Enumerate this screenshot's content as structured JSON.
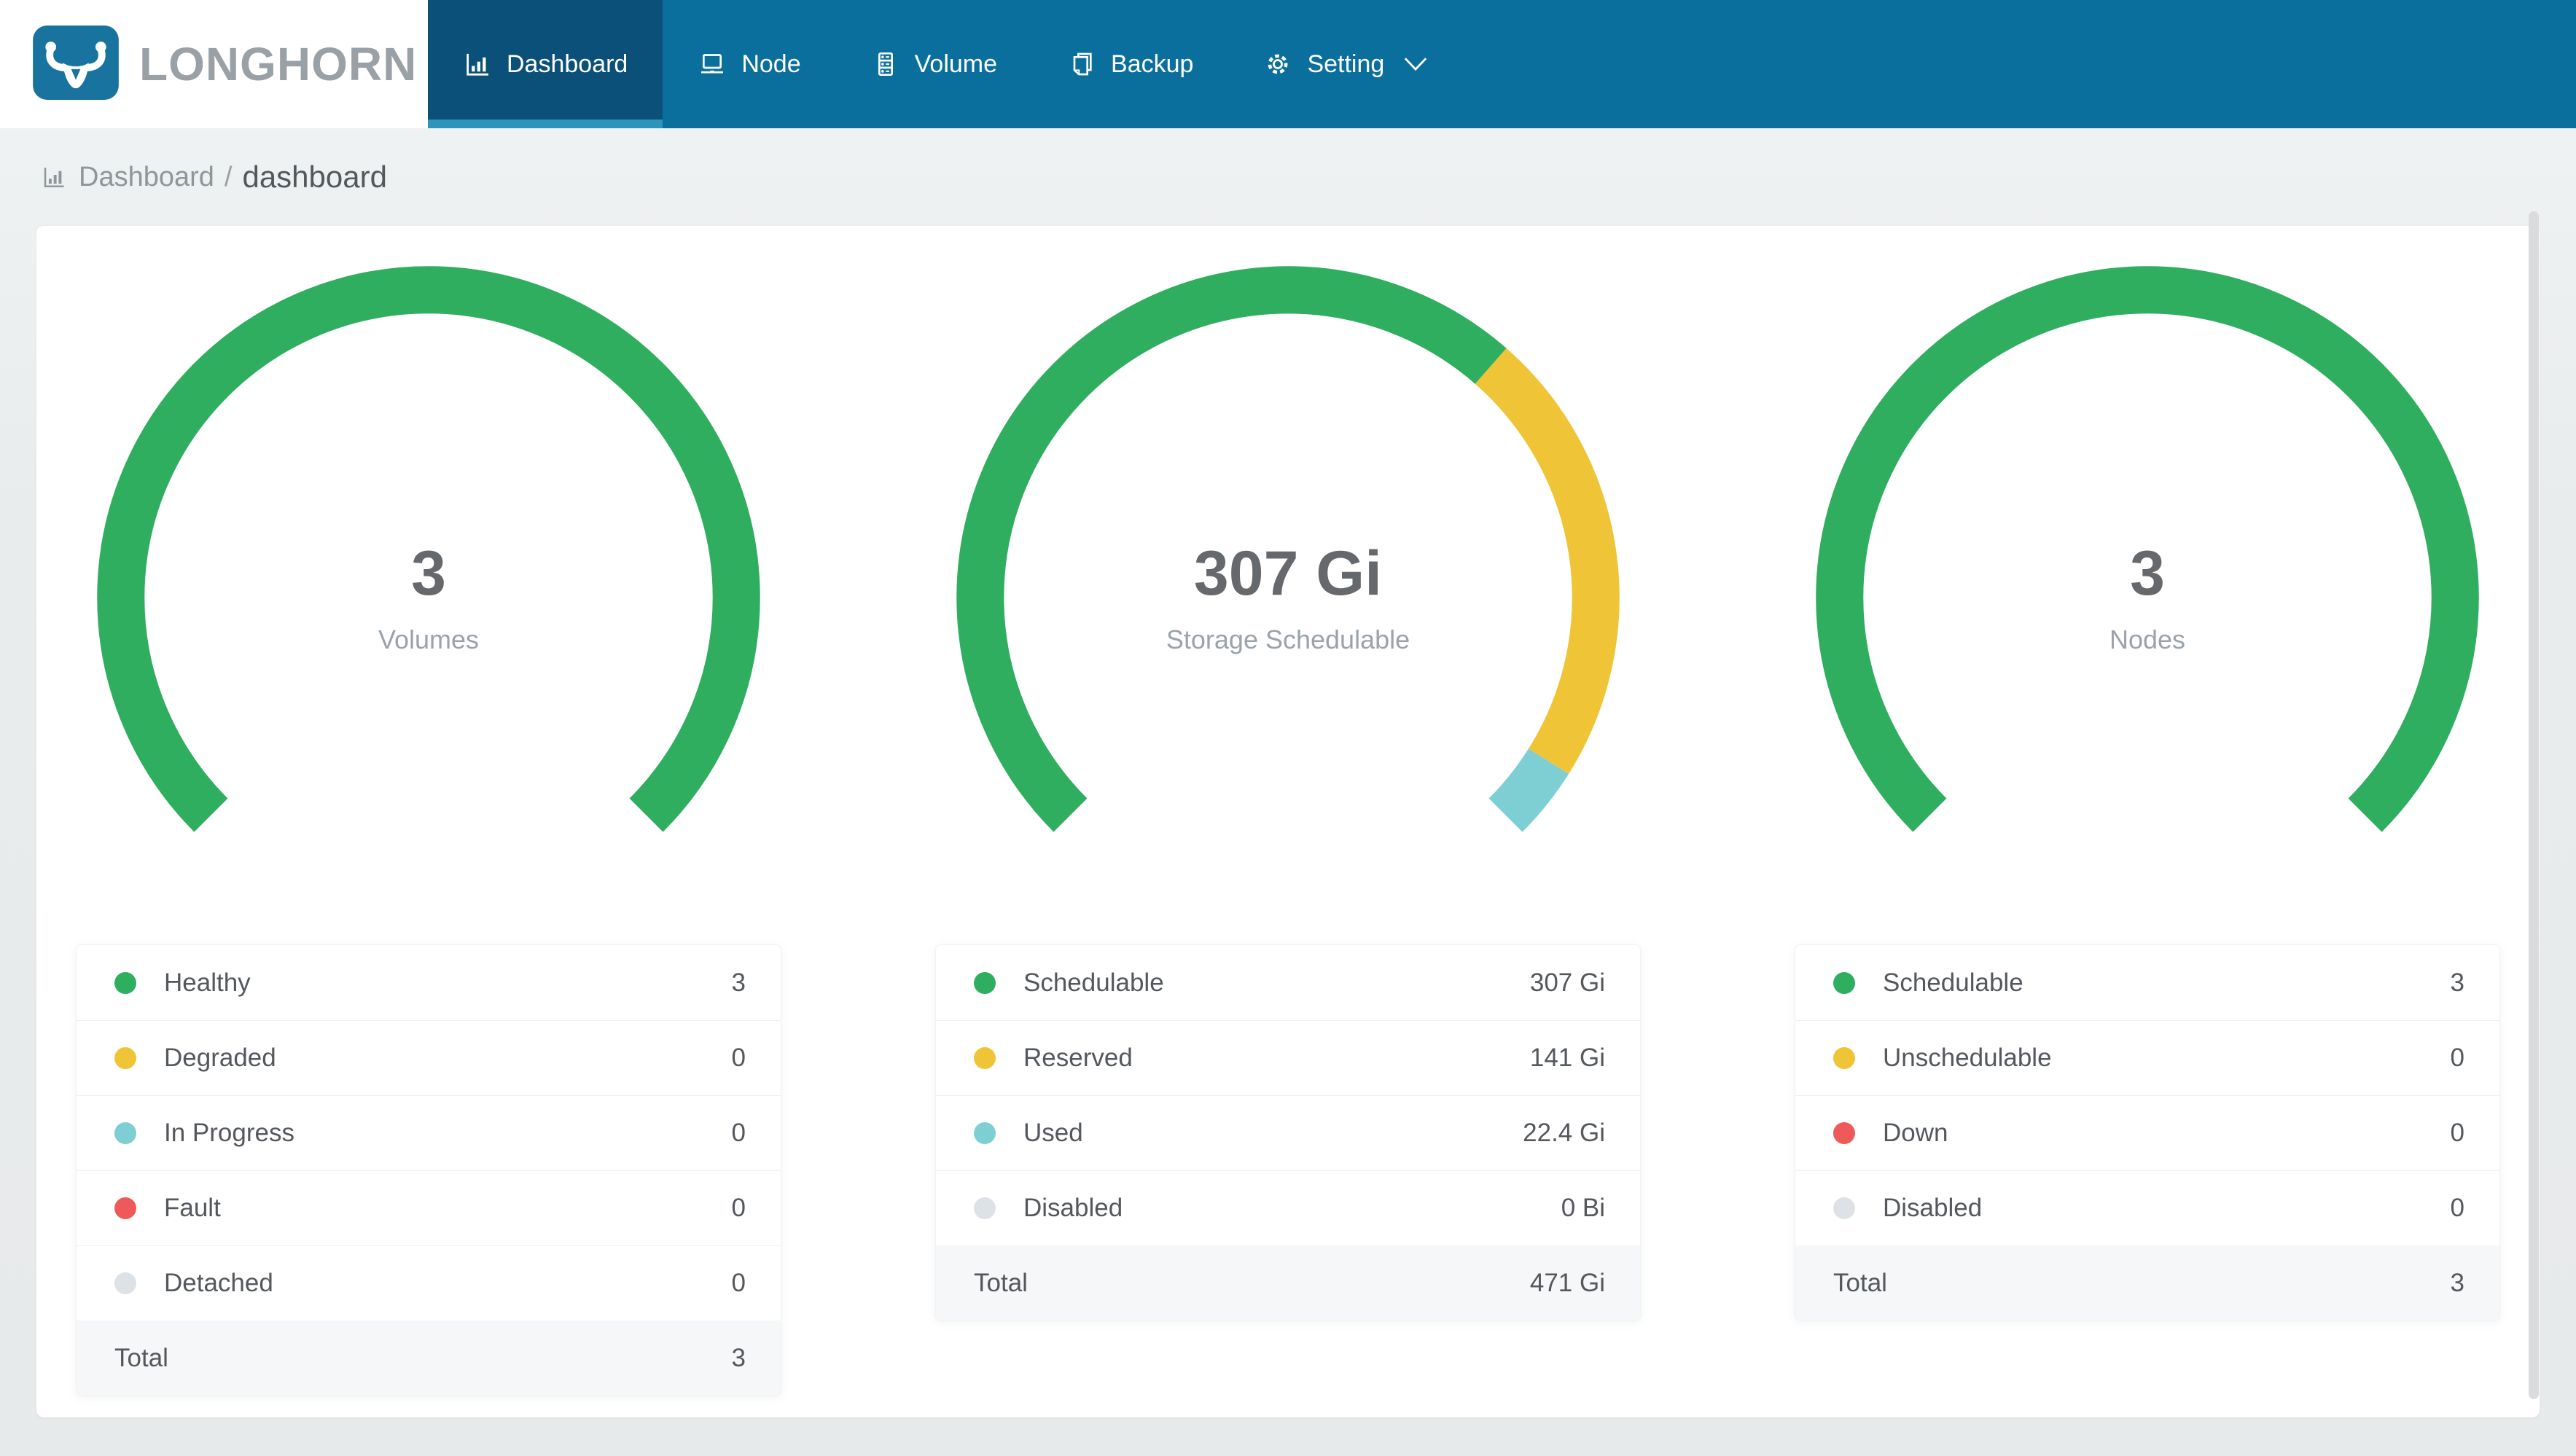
{
  "brand": {
    "name": "LONGHORN"
  },
  "colors": {
    "green": "#2fae5f",
    "yellow": "#f0c437",
    "teal": "#7ecfd4",
    "red": "#ee5a5a",
    "gray": "#dde2e6",
    "navbar": "#0b6f9d",
    "navbar_active_bg": "#0a5078",
    "navbar_active_underline": "#2b96ba",
    "logo_blue": "#18739f"
  },
  "nav": {
    "items": [
      {
        "label": "Dashboard",
        "icon": "bar-chart-icon",
        "active": true
      },
      {
        "label": "Node",
        "icon": "laptop-icon",
        "active": false
      },
      {
        "label": "Volume",
        "icon": "server-icon",
        "active": false
      },
      {
        "label": "Backup",
        "icon": "copy-icon",
        "active": false
      },
      {
        "label": "Setting",
        "icon": "gear-icon",
        "active": false,
        "has_dropdown": true
      }
    ]
  },
  "breadcrumb": {
    "section": "Dashboard",
    "separator": "/",
    "page": "dashboard"
  },
  "chart_data": [
    {
      "type": "gauge",
      "center_value": "3",
      "subtitle": "Volumes",
      "start_angle": 225,
      "arc_span": 270,
      "segments": [
        {
          "label": "Healthy",
          "value": 3,
          "display": "3",
          "color": "green"
        },
        {
          "label": "Degraded",
          "value": 0,
          "display": "0",
          "color": "yellow"
        },
        {
          "label": "In Progress",
          "value": 0,
          "display": "0",
          "color": "teal"
        },
        {
          "label": "Fault",
          "value": 0,
          "display": "0",
          "color": "red"
        },
        {
          "label": "Detached",
          "value": 0,
          "display": "0",
          "color": "gray"
        }
      ],
      "total": {
        "label": "Total",
        "display": "3"
      }
    },
    {
      "type": "gauge",
      "center_value": "307 Gi",
      "subtitle": "Storage Schedulable",
      "start_angle": 225,
      "arc_span": 270,
      "segments": [
        {
          "label": "Schedulable",
          "value": 307,
          "display": "307 Gi",
          "color": "green"
        },
        {
          "label": "Reserved",
          "value": 141,
          "display": "141 Gi",
          "color": "yellow"
        },
        {
          "label": "Used",
          "value": 22.4,
          "display": "22.4 Gi",
          "color": "teal"
        },
        {
          "label": "Disabled",
          "value": 0,
          "display": "0 Bi",
          "color": "gray"
        }
      ],
      "total": {
        "label": "Total",
        "display": "471 Gi"
      }
    },
    {
      "type": "gauge",
      "center_value": "3",
      "subtitle": "Nodes",
      "start_angle": 225,
      "arc_span": 270,
      "segments": [
        {
          "label": "Schedulable",
          "value": 3,
          "display": "3",
          "color": "green"
        },
        {
          "label": "Unschedulable",
          "value": 0,
          "display": "0",
          "color": "yellow"
        },
        {
          "label": "Down",
          "value": 0,
          "display": "0",
          "color": "red"
        },
        {
          "label": "Disabled",
          "value": 0,
          "display": "0",
          "color": "gray"
        }
      ],
      "total": {
        "label": "Total",
        "display": "3"
      }
    }
  ]
}
